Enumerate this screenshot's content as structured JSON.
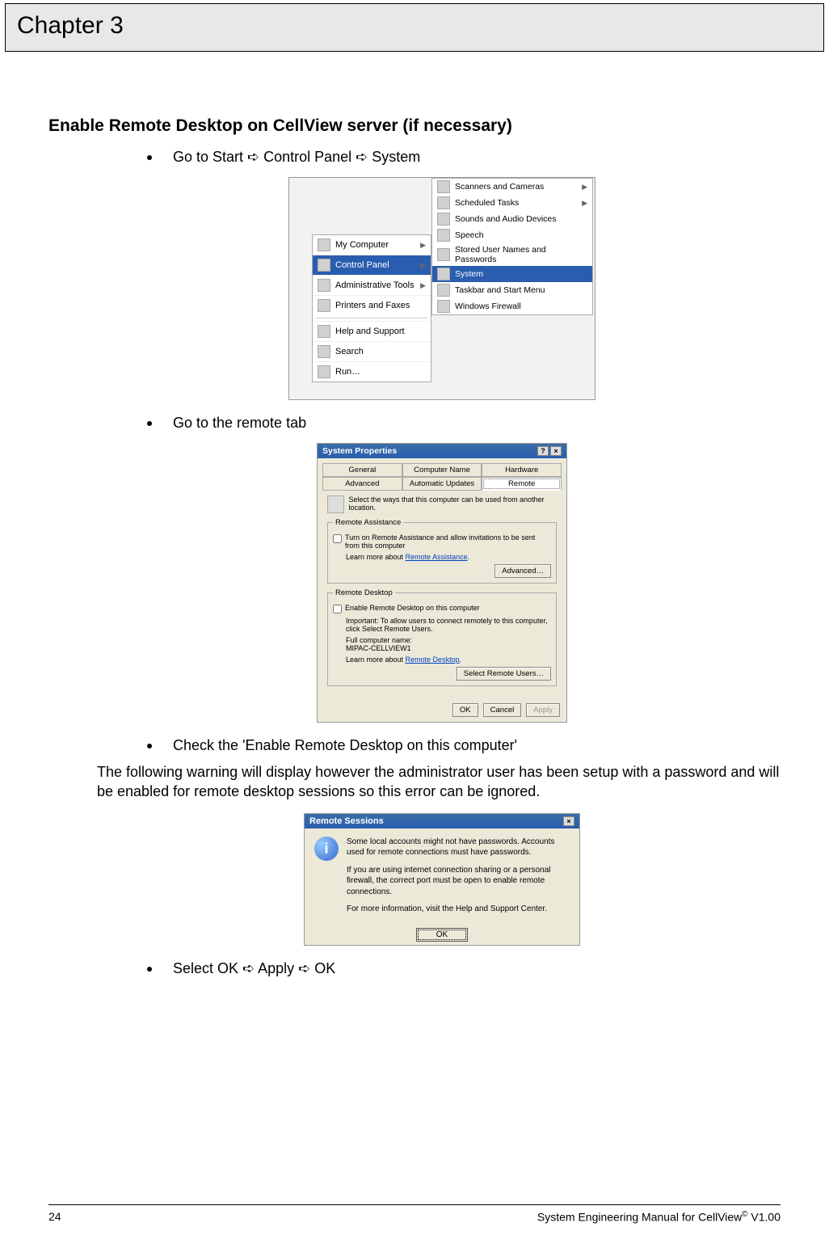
{
  "chapter": {
    "title": "Chapter 3"
  },
  "section": {
    "heading": "Enable Remote Desktop on CellView server (if necessary)"
  },
  "bullets": {
    "b1": "Go to Start ➪ Control Panel ➪ System",
    "b2": "Go to the remote tab",
    "b3": "Check the 'Enable Remote Desktop on this computer'",
    "b4": "Select OK ➪ Apply ➪ OK"
  },
  "paragraph": {
    "warn": "The following warning will display however the administrator user has been setup with a password and will be enabled for remote desktop sessions so this error can be ignored."
  },
  "fig1": {
    "start": {
      "my_computer": "My Computer",
      "control_panel": "Control Panel",
      "admin_tools": "Administrative Tools",
      "printers": "Printers and Faxes",
      "help": "Help and Support",
      "search": "Search",
      "run": "Run…"
    },
    "sub": {
      "scanners": "Scanners and Cameras",
      "scheduled": "Scheduled Tasks",
      "sounds": "Sounds and Audio Devices",
      "speech": "Speech",
      "stored": "Stored User Names and Passwords",
      "system": "System",
      "taskbar": "Taskbar and Start Menu",
      "firewall": "Windows Firewall"
    }
  },
  "fig2": {
    "title": "System Properties",
    "tabs": {
      "general": "General",
      "computer_name": "Computer Name",
      "hardware": "Hardware",
      "advanced": "Advanced",
      "auto_updates": "Automatic Updates",
      "remote": "Remote"
    },
    "intro": "Select the ways that this computer can be used from another location.",
    "ra": {
      "legend": "Remote Assistance",
      "checkbox": "Turn on Remote Assistance and allow invitations to be sent from this computer",
      "learn_prefix": "Learn more about ",
      "learn_link": "Remote Assistance",
      "advanced_btn": "Advanced…"
    },
    "rd": {
      "legend": "Remote Desktop",
      "checkbox": "Enable Remote Desktop on this computer",
      "important": "Important: To allow users to connect remotely to this computer, click Select Remote Users.",
      "full_name_label": "Full computer name:",
      "full_name_value": "MIPAC-CELLVIEW1",
      "learn_prefix": "Learn more about ",
      "learn_link": "Remote Desktop",
      "select_users_btn": "Select Remote Users…"
    },
    "buttons": {
      "ok": "OK",
      "cancel": "Cancel",
      "apply": "Apply"
    }
  },
  "fig3": {
    "title": "Remote Sessions",
    "msg1": "Some local accounts might not have passwords. Accounts used for remote connections must have passwords.",
    "msg2": "If you are using internet connection sharing or a personal firewall, the correct port must be open to enable remote connections.",
    "msg3": "For more information, visit the Help and Support Center.",
    "ok": "OK"
  },
  "footer": {
    "page": "24",
    "doc_prefix": "System Engineering Manual for CellView",
    "doc_suffix": " V1.00",
    "reg": "©"
  }
}
